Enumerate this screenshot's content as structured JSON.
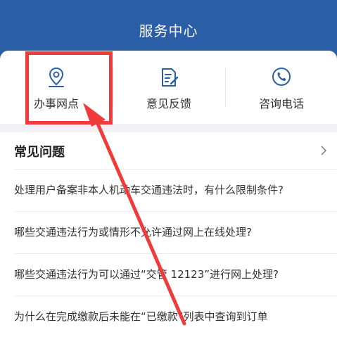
{
  "header": {
    "title": "服务中心"
  },
  "quick_actions": [
    {
      "label": "办事网点",
      "icon": "map-pin-icon"
    },
    {
      "label": "意见反馈",
      "icon": "feedback-icon"
    },
    {
      "label": "咨询电话",
      "icon": "phone-icon"
    }
  ],
  "faq": {
    "title": "常见问题",
    "items": [
      "处理用户备案非本人机动车交通违法时，有什么限制条件?",
      "哪些交通违法行为或情形不允许通过网上在线处理?",
      "哪些交通违法行为可以通过“交管 12123”进行网上处理?",
      "为什么在完成缴款后未能在“已缴款”列表中查询到订单"
    ]
  },
  "colors": {
    "header": "#2a5ea6",
    "icon": "#2a5ea6",
    "annotation": "#ef3b3b"
  }
}
